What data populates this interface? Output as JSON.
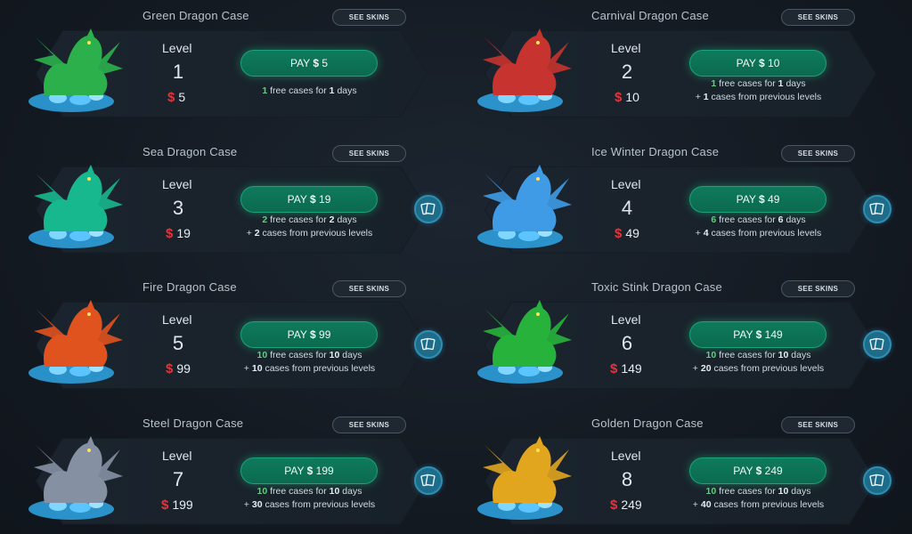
{
  "colors": {
    "accent_green": "#0f7a5c",
    "dollar_red": "#e8333a",
    "free_green": "#5cd27a",
    "cards_blue": "#1d6c8a"
  },
  "labels": {
    "see_skins": "SEE SKINS",
    "level": "Level",
    "pay_prefix": "PAY",
    "currency": "$",
    "free_cases_for": "free cases for",
    "days": "days",
    "plus": "+",
    "cases_from_previous": "cases from previous levels"
  },
  "cases": [
    {
      "title": "Green Dragon Case",
      "level": "1",
      "price": "5",
      "free_cases": "1",
      "free_days": "1",
      "prev_cases": null,
      "dragon_icon": "green-dragon-icon",
      "dragon_color": "#2bb04c"
    },
    {
      "title": "Carnival Dragon Case",
      "level": "2",
      "price": "10",
      "free_cases": "1",
      "free_days": "1",
      "prev_cases": "1",
      "dragon_icon": "carnival-dragon-icon",
      "dragon_color": "#c7332f"
    },
    {
      "title": "Sea Dragon Case",
      "level": "3",
      "price": "19",
      "free_cases": "2",
      "free_days": "2",
      "prev_cases": "2",
      "dragon_icon": "sea-dragon-icon",
      "dragon_color": "#18b88e"
    },
    {
      "title": "Ice Winter Dragon Case",
      "level": "4",
      "price": "49",
      "free_cases": "6",
      "free_days": "6",
      "prev_cases": "4",
      "dragon_icon": "ice-dragon-icon",
      "dragon_color": "#3f9be6"
    },
    {
      "title": "Fire Dragon Case",
      "level": "5",
      "price": "99",
      "free_cases": "10",
      "free_days": "10",
      "prev_cases": "10",
      "dragon_icon": "fire-dragon-icon",
      "dragon_color": "#e0531f"
    },
    {
      "title": "Toxic Stink Dragon Case",
      "level": "6",
      "price": "149",
      "free_cases": "10",
      "free_days": "10",
      "prev_cases": "20",
      "dragon_icon": "toxic-dragon-icon",
      "dragon_color": "#27b23b"
    },
    {
      "title": "Steel Dragon Case",
      "level": "7",
      "price": "199",
      "free_cases": "10",
      "free_days": "10",
      "prev_cases": "30",
      "dragon_icon": "steel-dragon-icon",
      "dragon_color": "#8591a3"
    },
    {
      "title": "Golden Dragon Case",
      "level": "8",
      "price": "249",
      "free_cases": "10",
      "free_days": "10",
      "prev_cases": "40",
      "dragon_icon": "golden-dragon-icon",
      "dragon_color": "#e1a51e"
    }
  ]
}
